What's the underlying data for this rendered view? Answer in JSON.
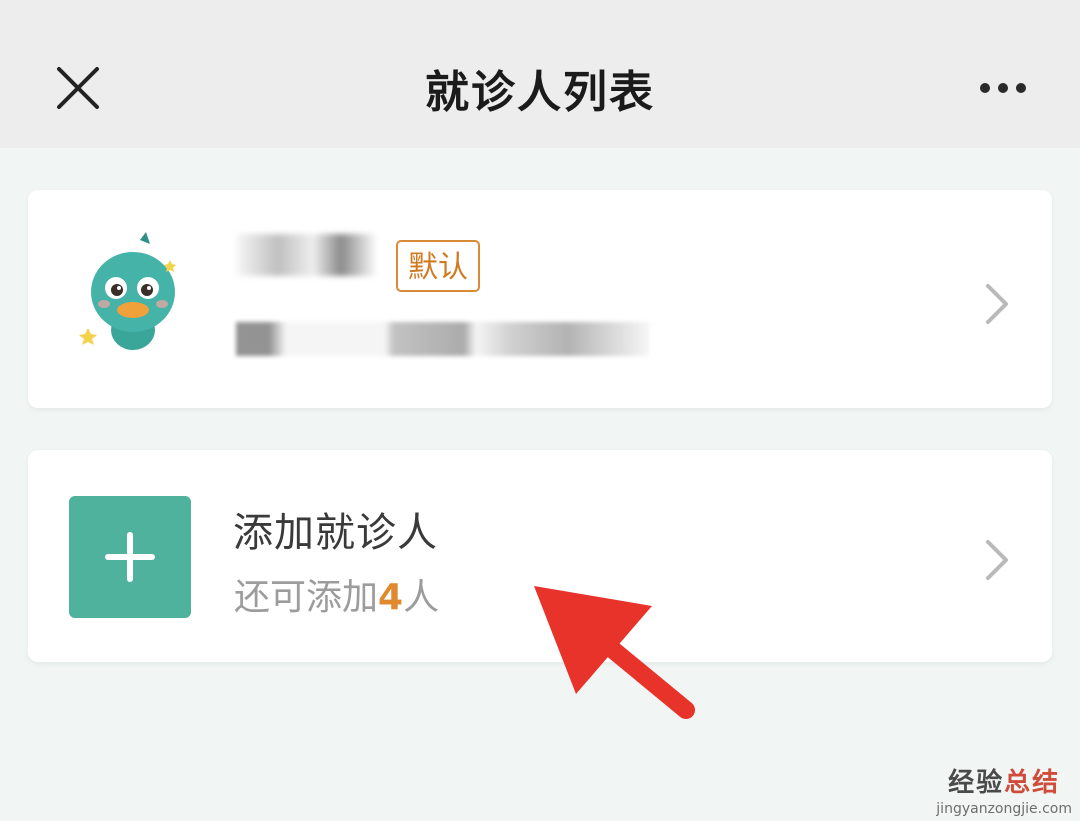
{
  "header": {
    "title": "就诊人列表",
    "close_icon": "close-icon",
    "more_icon": "more-icon"
  },
  "patient_card": {
    "badge": "默认",
    "avatar_icon": "duck-avatar-icon",
    "chevron_icon": "chevron-right-icon"
  },
  "add_card": {
    "title": "添加就诊人",
    "subtitle_prefix": "还可添加",
    "remaining": "4",
    "subtitle_suffix": "人",
    "plus_icon": "plus-icon",
    "chevron_icon": "chevron-right-icon"
  },
  "watermark": {
    "main_part1": "经验",
    "main_part2": "总结",
    "url": "jingyanzongjie.com"
  },
  "colors": {
    "accent_green": "#4fb29d",
    "badge_orange": "#d98a38",
    "count_orange": "#e0892e",
    "arrow_red": "#e8332b"
  }
}
